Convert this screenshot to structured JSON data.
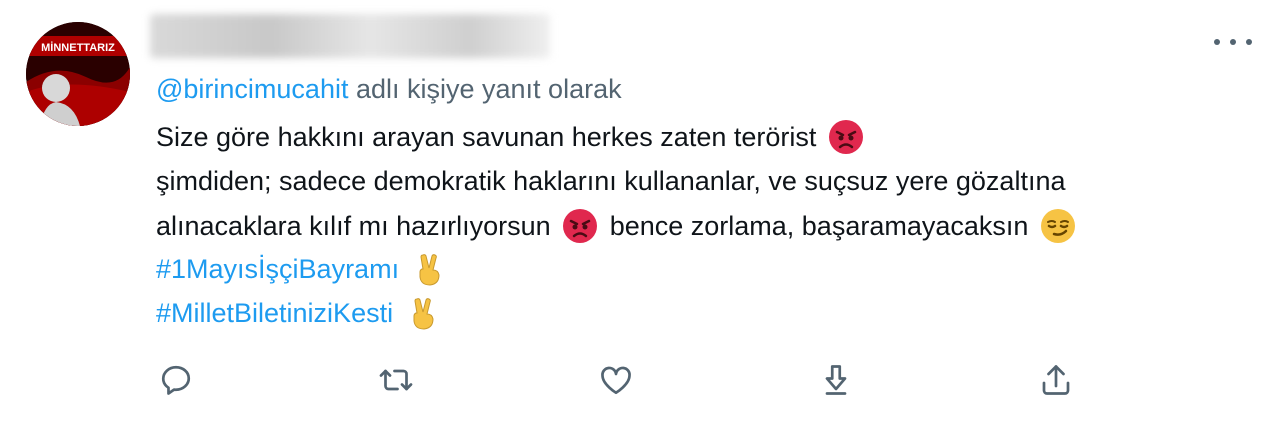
{
  "tweet": {
    "avatar_text": "MİNNETTARIZ",
    "reply_to": {
      "handle": "@birincimucahit",
      "suffix": " adlı kişiye yanıt olarak"
    },
    "lines": [
      {
        "before": "Size göre hakkını arayan savunan herkes zaten terörist",
        "emoji": "angry-face"
      },
      {
        "before": "şimdiden; sadece demokratik haklarını kullananlar, ve suçsuz yere gözaltına"
      },
      {
        "before": "alınacaklara kılıf mı hazırlıyorsun",
        "emoji1": "angry-face",
        "after": "bence zorlama, başaramayacaksın",
        "emoji2": "smirking-face"
      }
    ],
    "hashtags": [
      {
        "text": "#1Mayısİşçi​Bayramı",
        "display": "#1MayısİşçiBayramı",
        "emoji": "victory-hand"
      },
      {
        "text": "#MilletBiletiniziKesti",
        "display": "#MilletBiletiniziKesti",
        "emoji": "victory-hand"
      }
    ]
  },
  "colors": {
    "link": "#1d9bf0",
    "secondary_text": "#536471",
    "text": "#0f1419",
    "angry": "#e0284e",
    "emoji_yellow": "#f6c344"
  },
  "actions": [
    "reply-icon",
    "retweet-icon",
    "like-icon",
    "download-icon",
    "share-icon"
  ]
}
